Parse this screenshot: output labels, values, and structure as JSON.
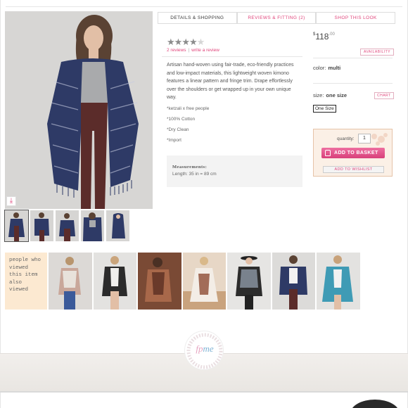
{
  "tabs": [
    "DETAILS & SHOPPING",
    "REVIEWS & FITTING (2)",
    "SHOP THIS LOOK"
  ],
  "rating": {
    "value": 4,
    "max": 5,
    "reviews_link": "2 reviews",
    "write_link": "write a review"
  },
  "description": "Artisan hand-woven using fair-trade, eco-friendly practices and low-impact materials, this lightweight woven kimono features a linear pattern and fringe trim. Drape effortlessly over the shoulders or get wrapped up in your own unique way.",
  "bullets": [
    "*ketzali x free people",
    "*100% Cotton",
    "*Dry Clean",
    "*Import"
  ],
  "measurements": {
    "title": "Measurements:",
    "value": "Length: 35 in = 89 cm"
  },
  "price": {
    "currency": "$",
    "amount": "118",
    "cents": ".00"
  },
  "availability_label": "AVAILABILITY",
  "color": {
    "label": "color:",
    "value": "multi"
  },
  "size": {
    "label": "size:",
    "value": "one size",
    "chart_label": "CHART",
    "selected": "One Size"
  },
  "buy": {
    "quantity_label": "quantity:",
    "quantity": "1",
    "add_basket": "ADD TO BASKET",
    "add_wishlist": "ADD TO WISHLIST"
  },
  "viewed_label": "people who viewed this item also viewed",
  "colors": {
    "accent": "#e0457b",
    "viewed_bg": "#fce9d1"
  }
}
